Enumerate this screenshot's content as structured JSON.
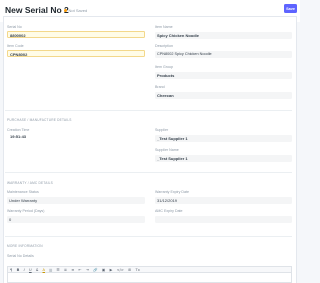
{
  "header": {
    "title": "New Serial No 2",
    "status": "Not Saved",
    "save_label": "Save"
  },
  "details": {
    "serial_no": {
      "label": "Serial No",
      "value": "8800002"
    },
    "item_code": {
      "label": "Item Code",
      "value": "CPN8002"
    },
    "item_name": {
      "label": "Item Name",
      "value": "Spicy Chicken Noodle"
    },
    "description": {
      "label": "Description",
      "value": "CPN8002 Spicy Chicken Noodle"
    },
    "item_group": {
      "label": "Item Group",
      "value": "Products"
    },
    "brand": {
      "label": "Brand",
      "value": "Cheecan"
    }
  },
  "purchase": {
    "section_title": "PURCHASE / MANUFACTURE DETAILS",
    "creation_time": {
      "label": "Creation Time",
      "value": "19:51:43"
    },
    "supplier": {
      "label": "Supplier",
      "value": "_Test Supplier 1"
    },
    "supplier_name": {
      "label": "Supplier Name",
      "value": "_Test Supplier 1"
    }
  },
  "warranty": {
    "section_title": "WARRANTY / AMC DETAILS",
    "maintenance_status": {
      "label": "Maintenance Status",
      "value": "Under Warranty"
    },
    "warranty_expiry": {
      "label": "Warranty Expiry Date",
      "value": "31/12/2019"
    },
    "warranty_period": {
      "label": "Warranty Period (Days)",
      "value": "0"
    },
    "amc_expiry": {
      "label": "AMC Expiry Date",
      "value": ""
    }
  },
  "more": {
    "section_title": "MORE INFORMATION",
    "serial_details_label": "Serial No Details"
  },
  "toolbar": {
    "style": "¶",
    "bold": "B",
    "italic": "I",
    "underline": "U",
    "strike": "S̶",
    "color": "A",
    "highlight": "▆",
    "ordered": "☰",
    "bullet": "≣",
    "align": "≡",
    "indent_less": "⇤",
    "indent_more": "⇥",
    "link": "🔗",
    "image": "▣",
    "video": "▶",
    "code": "</>",
    "table": "⊞",
    "clear": "Tx"
  },
  "colors": {
    "accent": "#5e64ff",
    "status_dot": "#ffa00a",
    "mandatory_bg": "#fffce7"
  }
}
